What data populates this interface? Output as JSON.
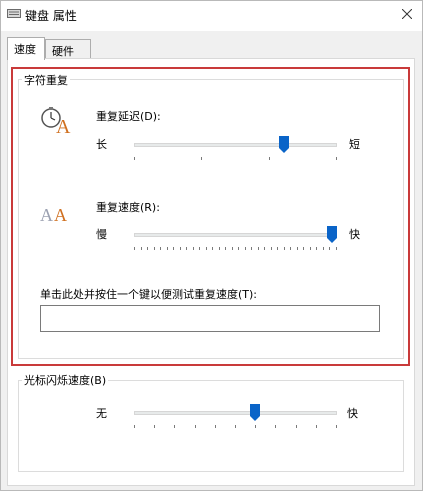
{
  "window": {
    "title": "键盘 属性"
  },
  "tabs": [
    {
      "label": "速度",
      "active": true
    },
    {
      "label": "硬件",
      "active": false
    }
  ],
  "char_repeat": {
    "group_label": "字符重复",
    "delay": {
      "label": "重复延迟(D):",
      "min_label": "长",
      "max_label": "短",
      "value": 0.75,
      "ticks": 4
    },
    "rate": {
      "label": "重复速度(R):",
      "min_label": "慢",
      "max_label": "快",
      "value": 1.0,
      "ticks": 32
    },
    "test_label": "单击此处并按住一个键以便测试重复速度(T):",
    "test_value": ""
  },
  "cursor_blink": {
    "group_label": "光标闪烁速度(B)",
    "min_label": "无",
    "max_label": "快",
    "value": 0.6,
    "ticks": 11
  },
  "highlight_color": "#c93a3a",
  "accent_color": "#0a64c8"
}
